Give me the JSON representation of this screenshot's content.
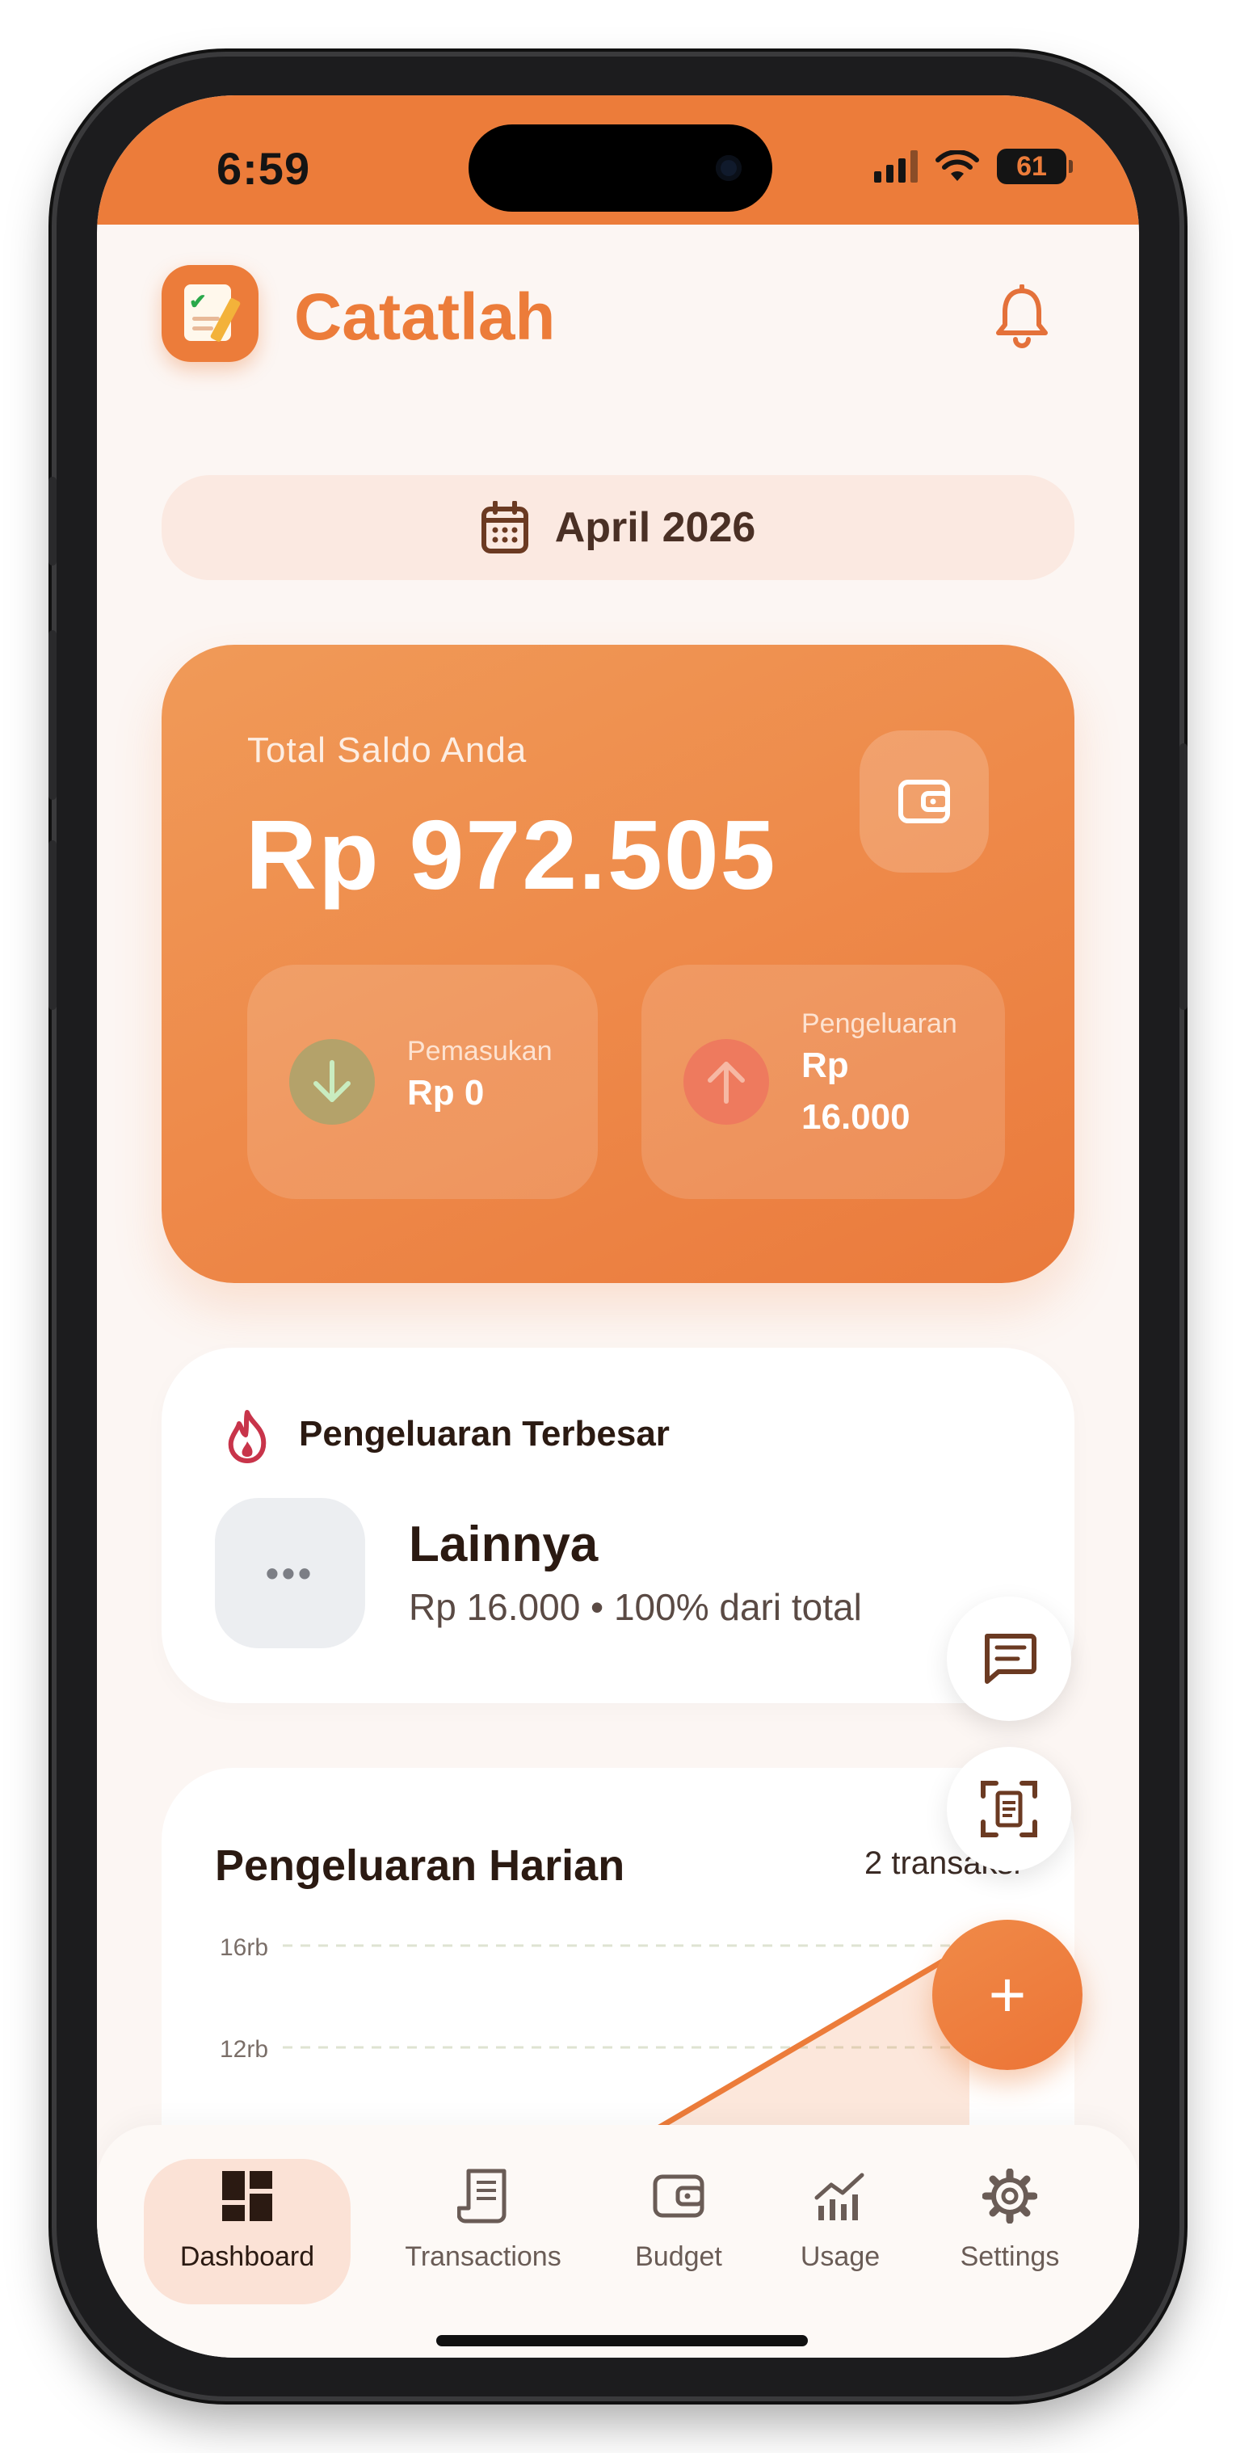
{
  "status_bar": {
    "time": "6:59",
    "battery": "61"
  },
  "header": {
    "app_name": "Catatlah"
  },
  "month_selector": {
    "label": "April 2026"
  },
  "balance": {
    "label": "Total Saldo Anda",
    "amount": "Rp 972.505",
    "income_label": "Pemasukan",
    "income_value": "Rp 0",
    "expense_label": "Pengeluaran",
    "expense_value_line1": "Rp",
    "expense_value_line2": "16.000"
  },
  "top_expense": {
    "title": "Pengeluaran Terbesar",
    "category": "Lainnya",
    "detail": "Rp 16.000 • 100% dari total",
    "icon_glyph": "•••"
  },
  "daily_expense": {
    "title": "Pengeluaran Harian",
    "count": "2 transaksi"
  },
  "chart_data": {
    "type": "area",
    "title": "Pengeluaran Harian",
    "y_ticks": [
      "16rb",
      "12rb"
    ],
    "ylim": [
      0,
      16000
    ],
    "grid": true,
    "series": [
      {
        "values": [
          0,
          16000
        ]
      }
    ]
  },
  "fab": {
    "main_symbol": "+"
  },
  "bottom_nav": {
    "items": [
      {
        "label": "Dashboard",
        "icon": "dashboard-icon",
        "active": true
      },
      {
        "label": "Transactions",
        "icon": "receipt-icon",
        "active": false
      },
      {
        "label": "Budget",
        "icon": "wallet-icon",
        "active": false
      },
      {
        "label": "Usage",
        "icon": "chart-icon",
        "active": false
      },
      {
        "label": "Settings",
        "icon": "gear-icon",
        "active": false
      }
    ]
  },
  "colors": {
    "accent": "#ec7c3a",
    "background": "#fcf6f3",
    "text_dark": "#2b1a12"
  }
}
